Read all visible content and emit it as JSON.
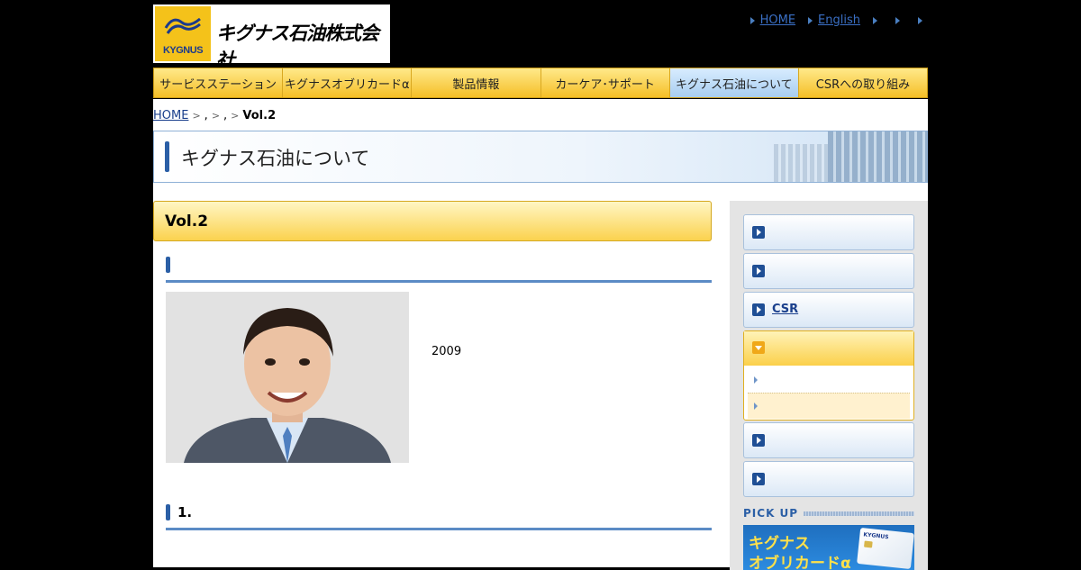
{
  "brand": {
    "logo_text": "KYGNUS",
    "company_name": "キグナス石油株式会社"
  },
  "util_nav": [
    {
      "label": "HOME"
    },
    {
      "label": "English"
    },
    {
      "label": ""
    },
    {
      "label": ""
    },
    {
      "label": ""
    }
  ],
  "global_nav": [
    {
      "label": "サービスステーション"
    },
    {
      "label": "キグナスオブリカードα"
    },
    {
      "label": "製品情報"
    },
    {
      "label": "カーケア･サポート"
    },
    {
      "label": "キグナス石油について",
      "active": true
    },
    {
      "label": "CSRへの取り組み"
    }
  ],
  "breadcrumb": {
    "home": "HOME",
    "sep1": ",",
    "sep2": ",",
    "current": "Vol.2"
  },
  "page_banner": {
    "title": "キグナス石油について"
  },
  "article": {
    "title": "Vol.2",
    "section1_heading": "",
    "intro_year": "2009",
    "section2_heading": "1."
  },
  "sidebar": {
    "items": [
      {
        "label": ""
      },
      {
        "label": ""
      },
      {
        "label": "CSR"
      }
    ],
    "open_group": {
      "label": "",
      "subitems": [
        {
          "label": ""
        },
        {
          "label": ""
        }
      ]
    },
    "items_after": [
      {
        "label": ""
      },
      {
        "label": ""
      }
    ],
    "pickup_label": "PICK UP",
    "pickup_banner": {
      "line1": "キグナス",
      "line2": "オブリカードα",
      "card_text": "KYGNUS"
    }
  },
  "colors": {
    "nav_gold": "#f7c932",
    "nav_active": "#a8cdf0",
    "accent_blue": "#2b5fa6",
    "link_blue": "#3a6fc4"
  }
}
